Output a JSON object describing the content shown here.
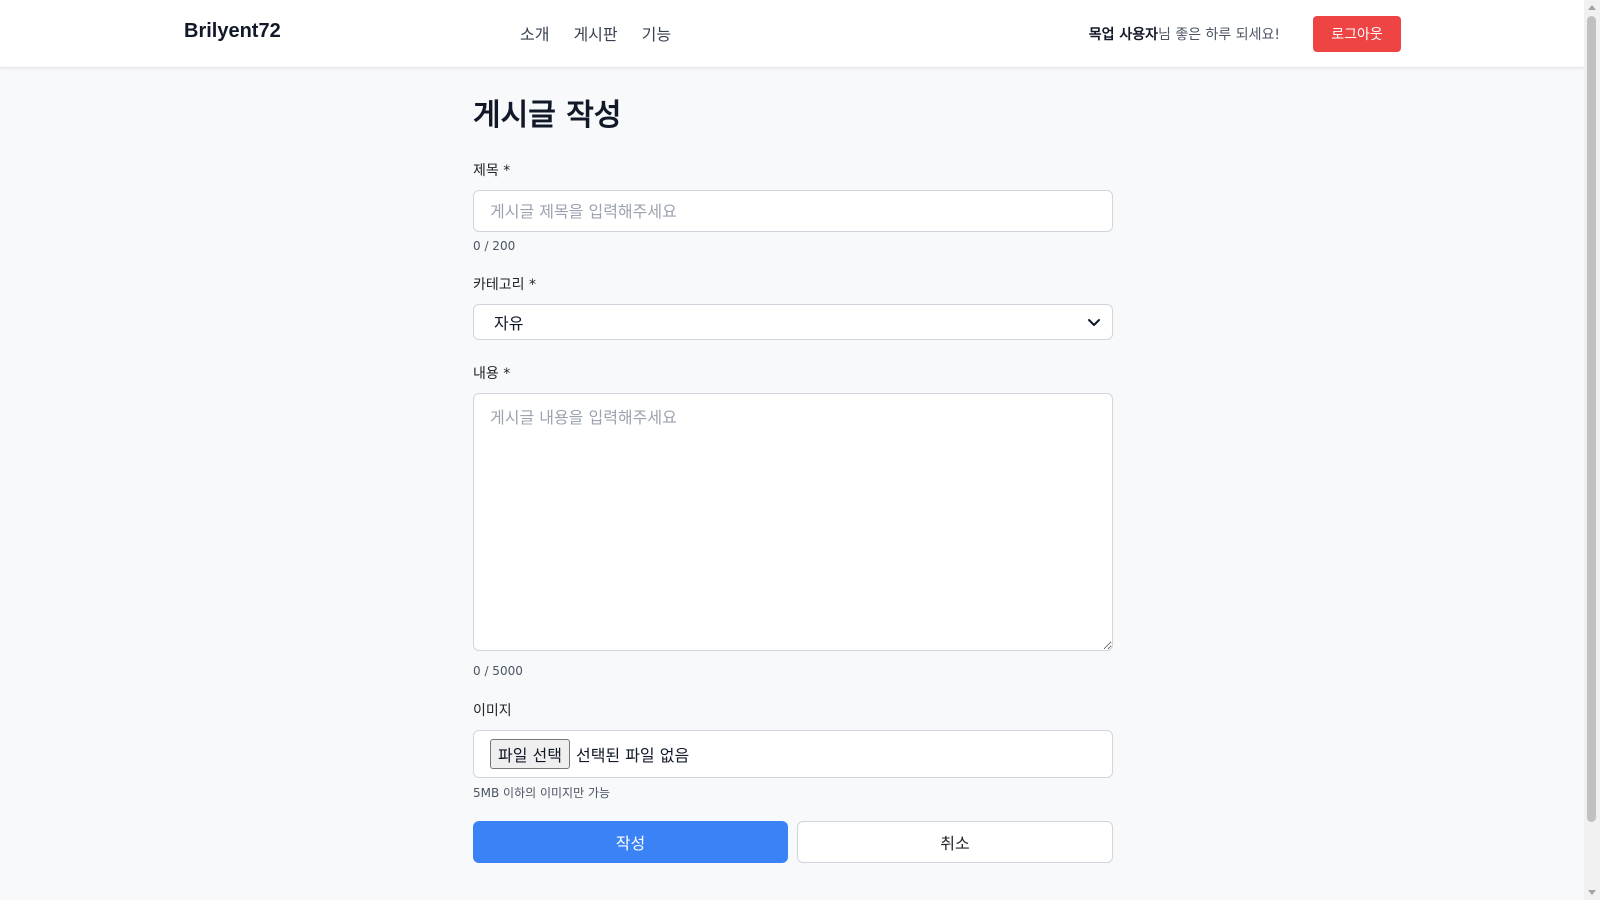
{
  "header": {
    "brand": "Brilyent72",
    "nav": [
      "소개",
      "게시판",
      "기능"
    ],
    "user_name": "목업 사용자",
    "greeting_suffix": "님 좋은 하루 되세요!",
    "logout_label": "로그아웃"
  },
  "form": {
    "page_title": "게시글 작성",
    "title_field": {
      "label": "제목 *",
      "placeholder": "게시글 제목을 입력해주세요",
      "counter": "0 / 200"
    },
    "category_field": {
      "label": "카테고리 *",
      "selected": "자유"
    },
    "content_field": {
      "label": "내용 *",
      "placeholder": "게시글 내용을 입력해주세요",
      "counter": "0 / 5000"
    },
    "image_field": {
      "label": "이미지",
      "button_label": "파일 선택",
      "status": "선택된 파일 없음",
      "hint": "5MB 이하의 이미지만 가능"
    },
    "submit_label": "작성",
    "cancel_label": "취소"
  },
  "colors": {
    "primary": "#3b82f6",
    "danger": "#ef4444",
    "background": "#f8f9fa"
  }
}
